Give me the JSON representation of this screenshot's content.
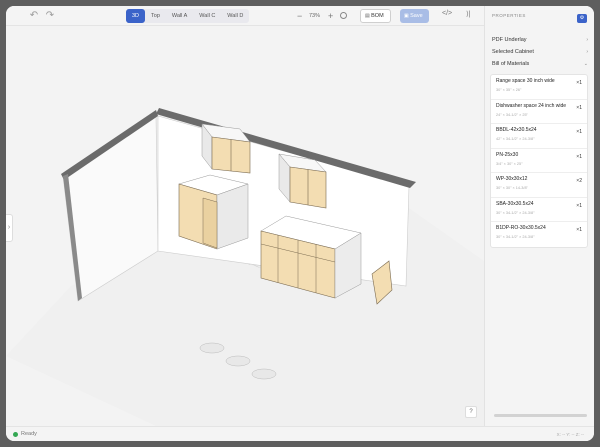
{
  "toolbar": {
    "view_tabs": [
      "3D",
      "Top",
      "Wall A",
      "Wall C",
      "Wall D"
    ],
    "active_tab": "3D",
    "zoom_level": "73%",
    "zoom_out": "−",
    "zoom_in": "+",
    "bom_label": "BOM",
    "save_label": "Save",
    "code_icon": "</>",
    "collapse_icon": "⟩|"
  },
  "panel": {
    "title": "PROPERTIES",
    "sections": [
      {
        "label": "PDF Underlay",
        "chevron": "›"
      },
      {
        "label": "Selected Cabinet",
        "chevron": "›"
      },
      {
        "label": "Bill of Materials",
        "chevron": "⌄"
      }
    ],
    "bom": [
      {
        "name": "Range space 30 inch wide",
        "dims": "30\" × 35\" × 26\"",
        "qty": "×1"
      },
      {
        "name": "Dishwasher space 24 inch wide",
        "dims": "24\" × 34-1/2\" × 25\"",
        "qty": "×1"
      },
      {
        "name": "BBDL-42x30.5x24",
        "dims": "42\" × 34-1/2\" × 24-3/8\"",
        "qty": "×1"
      },
      {
        "name": "PN-25x30",
        "dims": "3/4\" × 30\" × 25\"",
        "qty": "×1"
      },
      {
        "name": "WP-30x30x12",
        "dims": "30\" × 30\" × 14-3/8\"",
        "qty": "×2"
      },
      {
        "name": "SBA-30x30.5x24",
        "dims": "30\" × 34-1/2\" × 24-3/8\"",
        "qty": "×1"
      },
      {
        "name": "B1DP-RO-30x30.5x24",
        "dims": "30\" × 34-1/2\" × 24-3/8\"",
        "qty": "×1"
      }
    ]
  },
  "canvas": {
    "left_handle": "›",
    "help_label": "?"
  },
  "status": {
    "text": "Ready",
    "coords": "X: -- Y: -- Z: --",
    "ready_color": "#34a853"
  },
  "colors": {
    "accent": "#3b63c9",
    "cabinet_face": "#f3ddb2",
    "wall_top": "#6b6b6b"
  }
}
